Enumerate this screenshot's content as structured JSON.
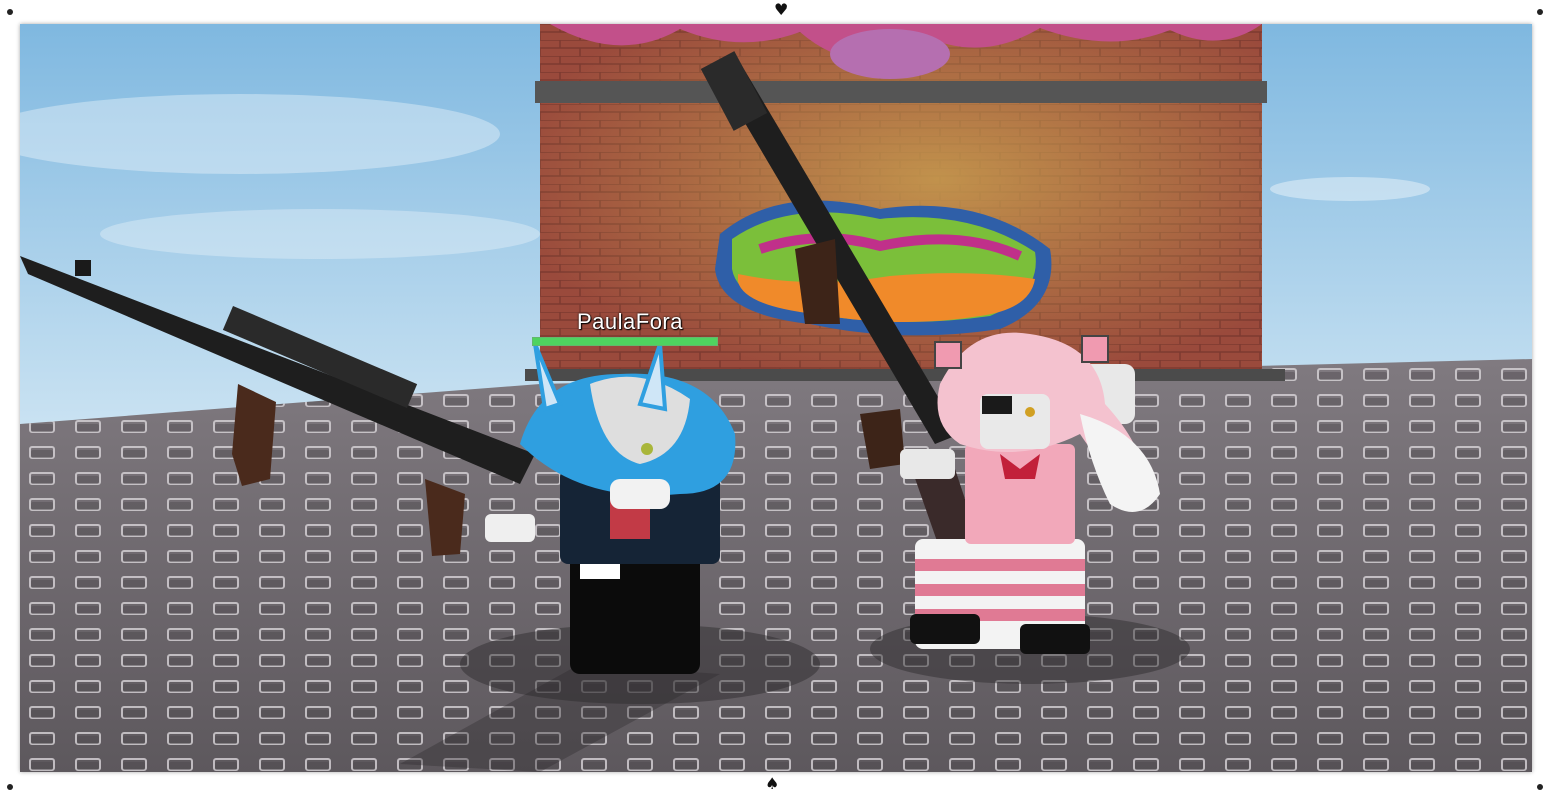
{
  "player": {
    "name": "PaulaFora",
    "health_fraction": 1.0
  },
  "colors": {
    "sky": "#8ec3e6",
    "baseplate": "#6f6a70",
    "brick": "#9a4a3c",
    "health": "#4fd35f"
  },
  "icons": {
    "top_handle": "heart-icon",
    "bottom_handle": "spade-icon"
  }
}
